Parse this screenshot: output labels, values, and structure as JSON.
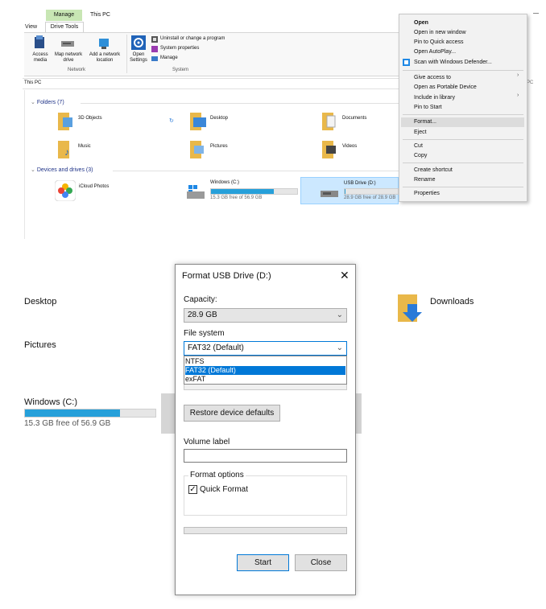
{
  "explorer": {
    "ribbon": {
      "manage_tab": "Manage",
      "this_pc_title": "This PC",
      "view_tab": "View",
      "drive_tools_tab": "Drive Tools",
      "access_media": "Access media",
      "map_network_drive": "Map network drive",
      "add_network_location": "Add a network location",
      "open_settings": "Open Settings",
      "uninstall": "Uninstall or change a program",
      "system_properties": "System properties",
      "manage": "Manage",
      "network_group": "Network",
      "system_group": "System"
    },
    "address": "This PC",
    "address_right": "PC",
    "folders_header": "Folders (7)",
    "folders": [
      "3D Objects",
      "Desktop",
      "Documents",
      "Music",
      "Pictures",
      "Videos"
    ],
    "devices_header": "Devices and drives (3)",
    "devices": {
      "icloud": "iCloud Photos",
      "windows_name": "Windows (C:)",
      "windows_free": "15.3 GB free of 56.9 GB",
      "windows_used_fraction": 0.73,
      "usb_name": "USB Drive (D:)",
      "usb_free": "28.9 GB free of 28.9 GB",
      "usb_used_fraction": 0.02
    }
  },
  "context_menu": {
    "items": [
      "Open",
      "Open in new window",
      "Pin to Quick access",
      "Open AutoPlay...",
      "Scan with Windows Defender...",
      "Give access to",
      "Open as Portable Device",
      "Include in library",
      "Pin to Start",
      "Format...",
      "Eject",
      "Cut",
      "Copy",
      "Create shortcut",
      "Rename",
      "Properties"
    ]
  },
  "background2": {
    "desktop": "Desktop",
    "downloads": "Downloads",
    "pictures": "Pictures",
    "windows_name": "Windows (C:)",
    "windows_free": "15.3 GB free of 56.9 GB"
  },
  "format_dialog": {
    "title": "Format USB Drive (D:)",
    "capacity_label": "Capacity:",
    "capacity_value": "28.9 GB",
    "file_system_label": "File system",
    "file_system_value": "FAT32 (Default)",
    "file_system_options": [
      "NTFS",
      "FAT32 (Default)",
      "exFAT"
    ],
    "restore_button": "Restore device defaults",
    "volume_label": "Volume label",
    "volume_value": "",
    "format_options_label": "Format options",
    "quick_format_label": "Quick Format",
    "quick_format_checked": true,
    "start_button": "Start",
    "close_button": "Close"
  }
}
